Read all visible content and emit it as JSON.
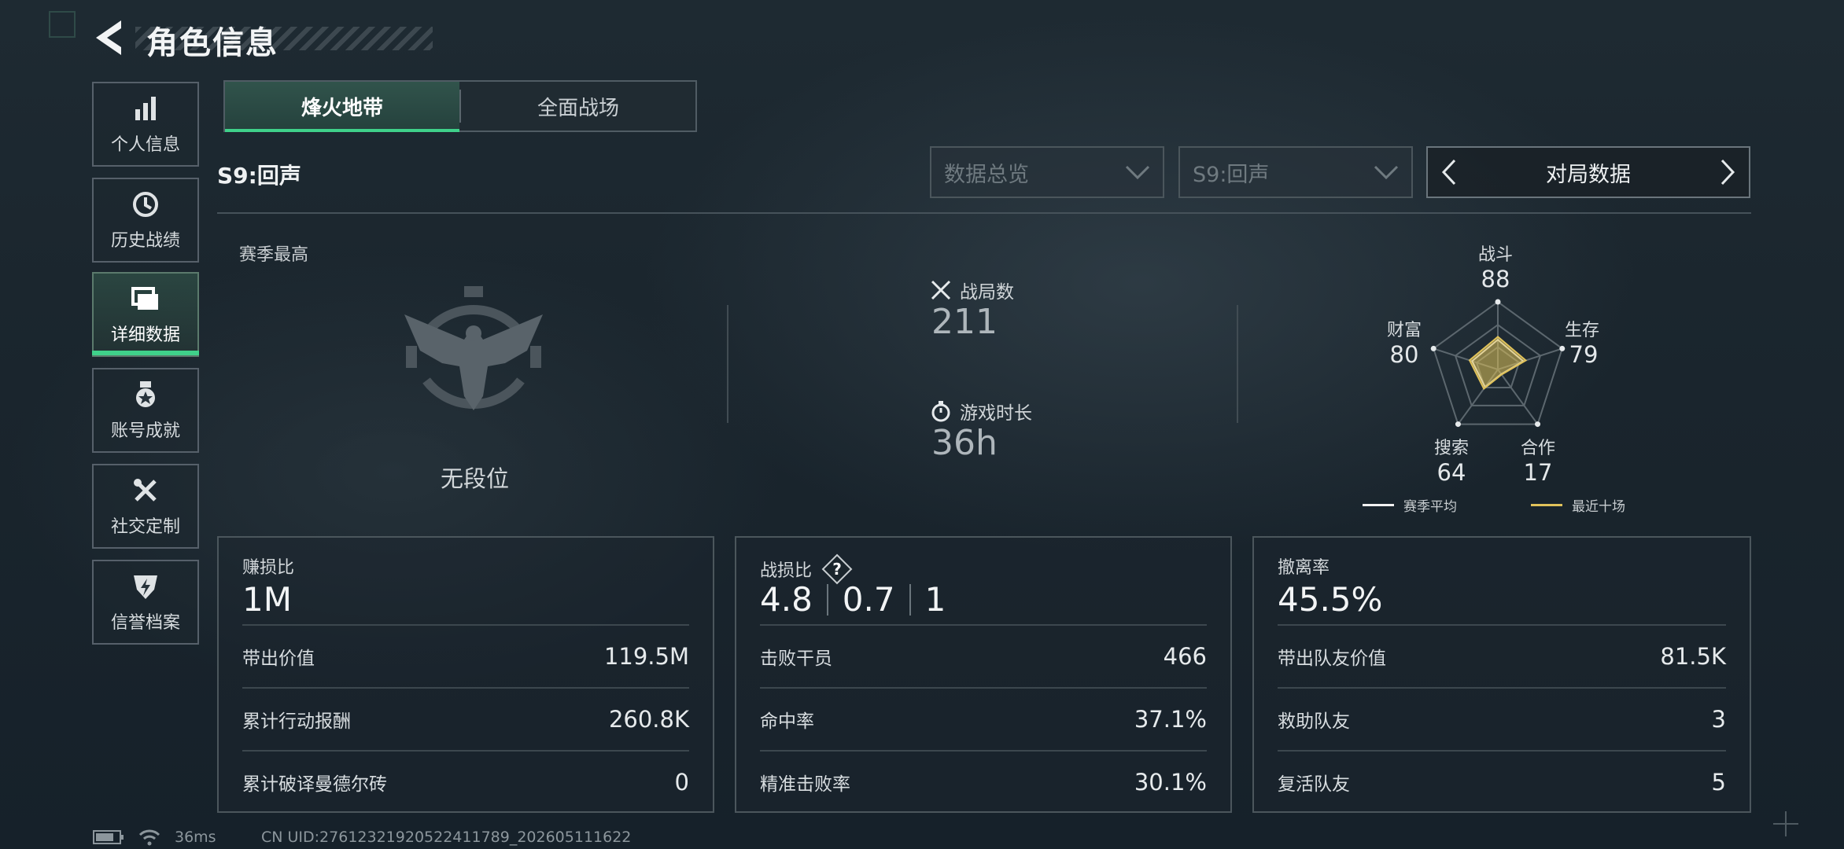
{
  "header": {
    "title": "角色信息"
  },
  "sidebar": {
    "items": [
      {
        "label": "个人信息",
        "icon": "bar-chart-icon"
      },
      {
        "label": "历史战绩",
        "icon": "history-clock-icon"
      },
      {
        "label": "详细数据",
        "icon": "folders-icon",
        "active": true
      },
      {
        "label": "账号成就",
        "icon": "medal-icon"
      },
      {
        "label": "社交定制",
        "icon": "tools-icon"
      },
      {
        "label": "信誉档案",
        "icon": "shield-lightning-icon"
      }
    ]
  },
  "tabs": [
    {
      "label": "烽火地带",
      "active": true
    },
    {
      "label": "全面战场",
      "active": false
    }
  ],
  "filters": {
    "season_label": "S9:回声",
    "dropdown_view": "数据总览",
    "dropdown_season": "S9:回声",
    "pager_label": "对局数据"
  },
  "overview": {
    "season_best_label": "赛季最高",
    "rank_text": "无段位",
    "matches_label": "战局数",
    "matches_value": "211",
    "playtime_label": "游戏时长",
    "playtime_value": "36h"
  },
  "radar": {
    "axes": [
      {
        "label": "战斗",
        "value": "88"
      },
      {
        "label": "生存",
        "value": "79"
      },
      {
        "label": "合作",
        "value": "17"
      },
      {
        "label": "搜索",
        "value": "64"
      },
      {
        "label": "财富",
        "value": "80"
      }
    ],
    "legend": [
      {
        "label": "赛季平均",
        "color": "#f2f2f2"
      },
      {
        "label": "最近十场",
        "color": "#e0c25a"
      }
    ],
    "accent_color": "#e0c25a"
  },
  "cards": [
    {
      "title": "赚损比",
      "big": "1M",
      "rows": [
        {
          "label": "带出价值",
          "value": "119.5M"
        },
        {
          "label": "累计行动报酬",
          "value": "260.8K"
        },
        {
          "label": "累计破译曼德尔砖",
          "value": "0"
        }
      ]
    },
    {
      "title": "战损比",
      "kd": [
        "4.8",
        "0.7",
        "1"
      ],
      "help_icon": "question-diamond-icon",
      "rows": [
        {
          "label": "击败干员",
          "value": "466"
        },
        {
          "label": "命中率",
          "value": "37.1%"
        },
        {
          "label": "精准击败率",
          "value": "30.1%"
        }
      ]
    },
    {
      "title": "撤离率",
      "big": "45.5%",
      "rows": [
        {
          "label": "带出队友价值",
          "value": "81.5K"
        },
        {
          "label": "救助队友",
          "value": "3"
        },
        {
          "label": "复活队友",
          "value": "5"
        }
      ]
    }
  ],
  "status": {
    "ping": "36ms",
    "uid": "CN UID:27612321920522411789_202605111622"
  },
  "colors": {
    "accent": "#3fd18a",
    "background": "#1c2830"
  }
}
